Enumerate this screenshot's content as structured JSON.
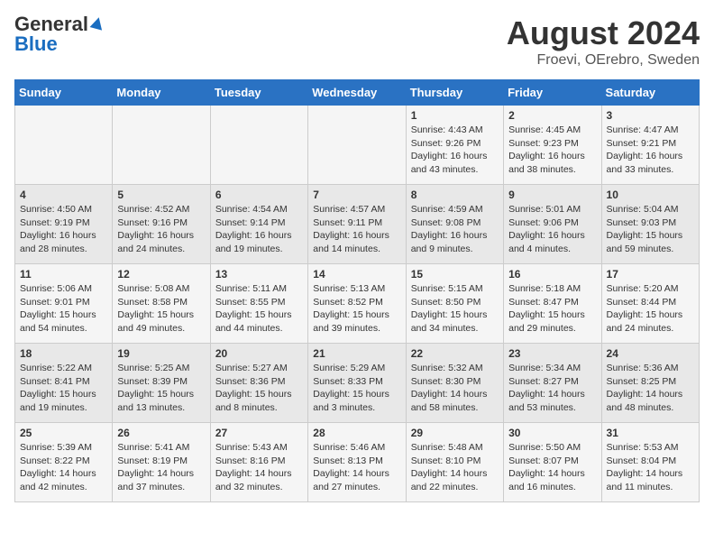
{
  "logo": {
    "general": "General",
    "blue": "Blue"
  },
  "title": "August 2024",
  "location": "Froevi, OErebro, Sweden",
  "days_of_week": [
    "Sunday",
    "Monday",
    "Tuesday",
    "Wednesday",
    "Thursday",
    "Friday",
    "Saturday"
  ],
  "weeks": [
    [
      {
        "day": "",
        "info": ""
      },
      {
        "day": "",
        "info": ""
      },
      {
        "day": "",
        "info": ""
      },
      {
        "day": "",
        "info": ""
      },
      {
        "day": "1",
        "info": "Sunrise: 4:43 AM\nSunset: 9:26 PM\nDaylight: 16 hours and 43 minutes."
      },
      {
        "day": "2",
        "info": "Sunrise: 4:45 AM\nSunset: 9:23 PM\nDaylight: 16 hours and 38 minutes."
      },
      {
        "day": "3",
        "info": "Sunrise: 4:47 AM\nSunset: 9:21 PM\nDaylight: 16 hours and 33 minutes."
      }
    ],
    [
      {
        "day": "4",
        "info": "Sunrise: 4:50 AM\nSunset: 9:19 PM\nDaylight: 16 hours and 28 minutes."
      },
      {
        "day": "5",
        "info": "Sunrise: 4:52 AM\nSunset: 9:16 PM\nDaylight: 16 hours and 24 minutes."
      },
      {
        "day": "6",
        "info": "Sunrise: 4:54 AM\nSunset: 9:14 PM\nDaylight: 16 hours and 19 minutes."
      },
      {
        "day": "7",
        "info": "Sunrise: 4:57 AM\nSunset: 9:11 PM\nDaylight: 16 hours and 14 minutes."
      },
      {
        "day": "8",
        "info": "Sunrise: 4:59 AM\nSunset: 9:08 PM\nDaylight: 16 hours and 9 minutes."
      },
      {
        "day": "9",
        "info": "Sunrise: 5:01 AM\nSunset: 9:06 PM\nDaylight: 16 hours and 4 minutes."
      },
      {
        "day": "10",
        "info": "Sunrise: 5:04 AM\nSunset: 9:03 PM\nDaylight: 15 hours and 59 minutes."
      }
    ],
    [
      {
        "day": "11",
        "info": "Sunrise: 5:06 AM\nSunset: 9:01 PM\nDaylight: 15 hours and 54 minutes."
      },
      {
        "day": "12",
        "info": "Sunrise: 5:08 AM\nSunset: 8:58 PM\nDaylight: 15 hours and 49 minutes."
      },
      {
        "day": "13",
        "info": "Sunrise: 5:11 AM\nSunset: 8:55 PM\nDaylight: 15 hours and 44 minutes."
      },
      {
        "day": "14",
        "info": "Sunrise: 5:13 AM\nSunset: 8:52 PM\nDaylight: 15 hours and 39 minutes."
      },
      {
        "day": "15",
        "info": "Sunrise: 5:15 AM\nSunset: 8:50 PM\nDaylight: 15 hours and 34 minutes."
      },
      {
        "day": "16",
        "info": "Sunrise: 5:18 AM\nSunset: 8:47 PM\nDaylight: 15 hours and 29 minutes."
      },
      {
        "day": "17",
        "info": "Sunrise: 5:20 AM\nSunset: 8:44 PM\nDaylight: 15 hours and 24 minutes."
      }
    ],
    [
      {
        "day": "18",
        "info": "Sunrise: 5:22 AM\nSunset: 8:41 PM\nDaylight: 15 hours and 19 minutes."
      },
      {
        "day": "19",
        "info": "Sunrise: 5:25 AM\nSunset: 8:39 PM\nDaylight: 15 hours and 13 minutes."
      },
      {
        "day": "20",
        "info": "Sunrise: 5:27 AM\nSunset: 8:36 PM\nDaylight: 15 hours and 8 minutes."
      },
      {
        "day": "21",
        "info": "Sunrise: 5:29 AM\nSunset: 8:33 PM\nDaylight: 15 hours and 3 minutes."
      },
      {
        "day": "22",
        "info": "Sunrise: 5:32 AM\nSunset: 8:30 PM\nDaylight: 14 hours and 58 minutes."
      },
      {
        "day": "23",
        "info": "Sunrise: 5:34 AM\nSunset: 8:27 PM\nDaylight: 14 hours and 53 minutes."
      },
      {
        "day": "24",
        "info": "Sunrise: 5:36 AM\nSunset: 8:25 PM\nDaylight: 14 hours and 48 minutes."
      }
    ],
    [
      {
        "day": "25",
        "info": "Sunrise: 5:39 AM\nSunset: 8:22 PM\nDaylight: 14 hours and 42 minutes."
      },
      {
        "day": "26",
        "info": "Sunrise: 5:41 AM\nSunset: 8:19 PM\nDaylight: 14 hours and 37 minutes."
      },
      {
        "day": "27",
        "info": "Sunrise: 5:43 AM\nSunset: 8:16 PM\nDaylight: 14 hours and 32 minutes."
      },
      {
        "day": "28",
        "info": "Sunrise: 5:46 AM\nSunset: 8:13 PM\nDaylight: 14 hours and 27 minutes."
      },
      {
        "day": "29",
        "info": "Sunrise: 5:48 AM\nSunset: 8:10 PM\nDaylight: 14 hours and 22 minutes."
      },
      {
        "day": "30",
        "info": "Sunrise: 5:50 AM\nSunset: 8:07 PM\nDaylight: 14 hours and 16 minutes."
      },
      {
        "day": "31",
        "info": "Sunrise: 5:53 AM\nSunset: 8:04 PM\nDaylight: 14 hours and 11 minutes."
      }
    ]
  ]
}
